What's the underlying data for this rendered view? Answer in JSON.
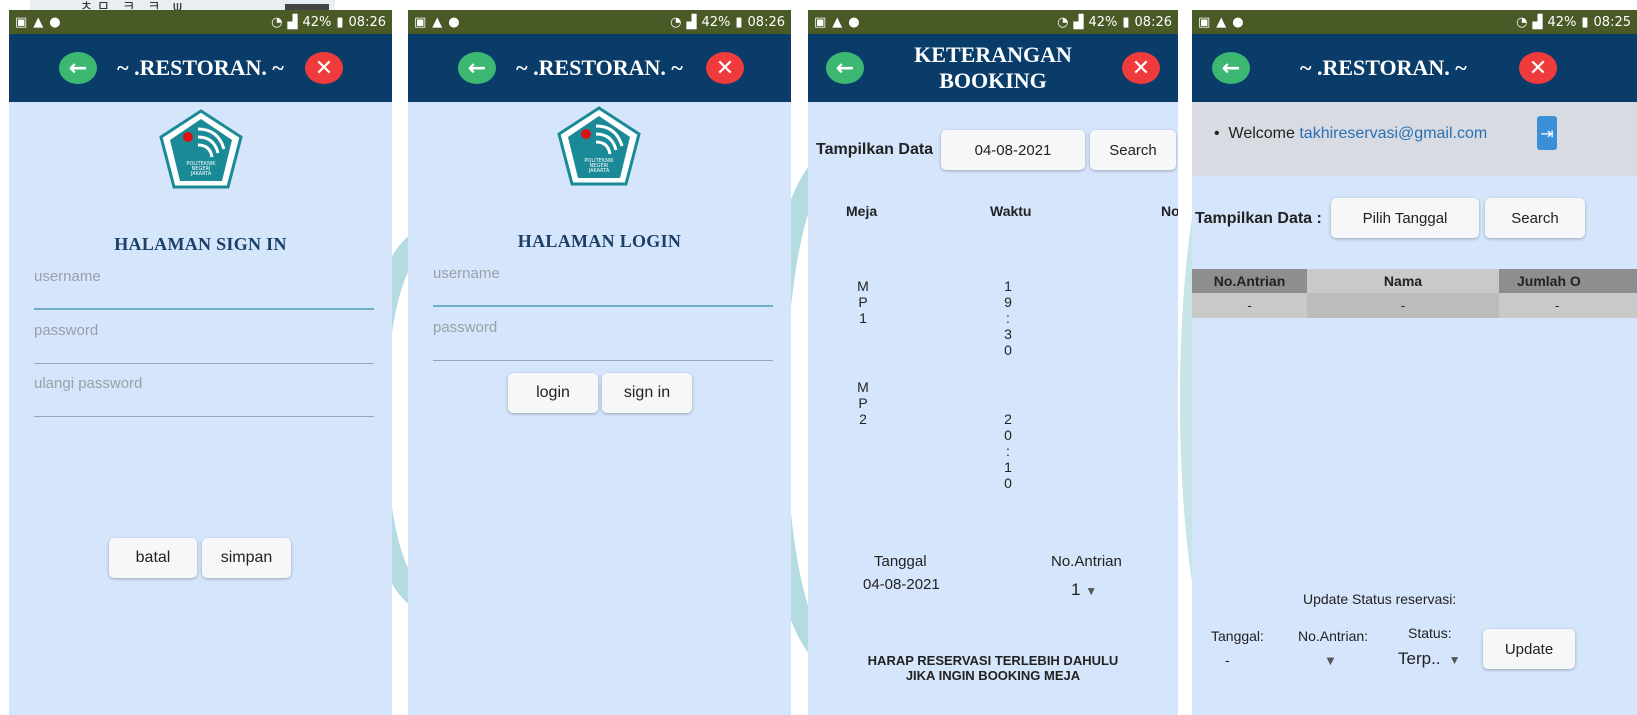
{
  "status_bar": {
    "signal": "42%",
    "time_1": "08:26",
    "time_2": "08:26",
    "time_3": "08:26",
    "time_4": "08:25"
  },
  "screen1": {
    "title": "~ .RESTORAN. ~",
    "heading": "HALAMAN SIGN IN",
    "username_placeholder": "username",
    "password_placeholder": "password",
    "repeat_password_placeholder": "ulangi password",
    "cancel_label": "batal",
    "save_label": "simpan"
  },
  "screen2": {
    "title": "~ .RESTORAN. ~",
    "heading": "HALAMAN LOGIN",
    "username_placeholder": "username",
    "password_placeholder": "password",
    "login_label": "login",
    "signin_label": "sign in"
  },
  "screen3": {
    "title_line1": "KETERANGAN",
    "title_line2": "BOOKING",
    "show_data_label": "Tampilkan Data",
    "date_value": "04-08-2021",
    "search_label": "Search",
    "col_table": "Meja",
    "col_time": "Waktu",
    "col_no_cut": "No",
    "rows": [
      {
        "table": "M\nP\n1",
        "time": "1\n9\n:\n3\n0"
      },
      {
        "table": "M\nP\n2",
        "time": "2\n0\n:\n1\n0"
      }
    ],
    "date_label": "Tanggal",
    "date_text": "04-08-2021",
    "queue_label": "No.Antrian",
    "queue_value": "1",
    "notice_line1": "HARAP RESERVASI TERLEBIH DAHULU",
    "notice_line2": "JIKA INGIN BOOKING MEJA"
  },
  "screen4": {
    "title": "~ .RESTORAN. ~",
    "welcome_prefix": "Welcome ",
    "welcome_email": "takhireservasi@gmail.com",
    "show_data_label": "Tampilkan Data :",
    "pick_date_label": "Pilih Tanggal",
    "search_label": "Search",
    "col_queue": "No.Antrian",
    "col_name": "Nama",
    "col_count_cut": "Jumlah O",
    "row_dash": "-",
    "update_heading": "Update Status reservasi:",
    "date_label": "Tanggal:",
    "date_value": "-",
    "queue_label": "No.Antrian:",
    "status_label": "Status:",
    "status_value": "Terp..",
    "update_label": "Update"
  },
  "colors": {
    "status_bar": "#4a5a27",
    "app_bar": "#0a3c6a",
    "screen_bg": "#d5e5fb",
    "back_button": "#3db873",
    "close_button": "#ef3b3b",
    "heading_text": "#1c3f68",
    "email_link": "#2a6fb4",
    "table_header_dark": "#8e8e8e",
    "table_header_light": "#c9c9c9"
  },
  "icons": [
    "image-icon",
    "warning-icon",
    "spotify-icon",
    "wifi-icon",
    "signal-icon",
    "battery-icon",
    "arrow-left-icon",
    "close-icon",
    "logout-icon",
    "chevron-down-icon",
    "pnj-logo"
  ]
}
